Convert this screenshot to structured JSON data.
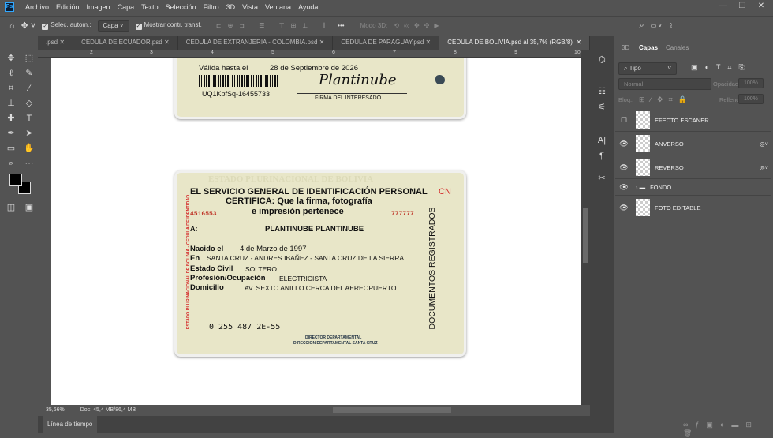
{
  "app": {
    "logo": "Ps"
  },
  "menu": [
    "Archivo",
    "Edición",
    "Imagen",
    "Capa",
    "Texto",
    "Selección",
    "Filtro",
    "3D",
    "Vista",
    "Ventana",
    "Ayuda"
  ],
  "window_controls": {
    "minimize": "—",
    "restore": "❐",
    "close": "✕"
  },
  "options": {
    "auto_select_label": "Selec. autom.:",
    "auto_select_checked": true,
    "auto_select_value": "Capa",
    "show_transform_label": "Mostrar contr. transf.",
    "show_transform_checked": true,
    "mode3d_label": "Modo 3D:",
    "more": "•••"
  },
  "tabs": [
    {
      "label": ".psd",
      "active": false
    },
    {
      "label": "CEDULA DE ECUADOR.psd",
      "active": false
    },
    {
      "label": "CEDULA DE EXTRANJERIA - COLOMBIA.psd",
      "active": false
    },
    {
      "label": "CEDULA DE PARAGUAY.psd",
      "active": false
    },
    {
      "label": "CEDULA DE BOLIVIA.psd al 35,7% (RGB/8)",
      "active": true
    }
  ],
  "tabs_overflow": ">>",
  "ruler": [
    "2",
    "3",
    "4",
    "5",
    "6",
    "7",
    "8",
    "9",
    "10"
  ],
  "card_front_top": {
    "valid_label": "Válida hasta el",
    "valid_date": "28 de Septiembre de 2026",
    "code": "UQ1KpfSq-16455733",
    "signature": "Plantinube",
    "signature_label": "FIRMA DEL INTERESADO"
  },
  "card_back": {
    "watermark": "ESTADO PLURINACIONAL DE BOLIVIA",
    "side_text": "ESTADO PLURINACIONAL DE BOLIVIA - CEDULA DE IDENTIDAD",
    "line1": "EL SERVICIO GENERAL DE IDENTIFICACIÓN PERSONAL",
    "line2": "CERTIFICA: Que la firma, fotografía",
    "line3": "e impresión pertenece",
    "number_left": "4516553",
    "number_right": "777777",
    "cn": "CN",
    "to_label": "A:",
    "name": "PLANTINUBE PLANTINUBE",
    "born_label": "Nacido el",
    "born": "4 de Marzo de 1997",
    "in_label": "En",
    "place": "SANTA CRUZ - ANDRES IBAÑEZ - SANTA CRUZ DE LA SIERRA",
    "civil_label": "Estado Civil",
    "civil": "SOLTERO",
    "job_label": "Profesión/Ocupación",
    "job": "ELECTRICISTA",
    "address_label": "Domicilio",
    "address": "AV. SEXTO ANILLO CERCA DEL AEREOPUERTO",
    "serial": "0 255 487 2E-55",
    "director1": "DIRECTOR DEPARTAMENTAL",
    "director2": "DIRECCION DEPARTAMENTAL SANTA CRUZ",
    "vertical": "DOCUMENTOS REGISTRADOS"
  },
  "status": {
    "zoom": "35,66%",
    "doc": "Doc: 45,4 MB/86,4 MB"
  },
  "timeline": {
    "label": "Línea de tiempo"
  },
  "panel": {
    "tabs": [
      "3D",
      "Capas",
      "Canales"
    ],
    "active_tab": "Capas",
    "filter": "Tipo",
    "blend": "Normal",
    "opacity_label": "Opacidad:",
    "opacity": "100%",
    "lock_label": "Bloq.:",
    "fill_label": "Relleno:",
    "fill": "100%",
    "layers": [
      {
        "name": "EFECTO ESCANER",
        "visible": false
      },
      {
        "name": "ANVERSO",
        "visible": true
      },
      {
        "name": "REVERSO",
        "visible": true
      },
      {
        "name": "FONDO",
        "visible": true,
        "group": true
      },
      {
        "name": "FOTO EDITABLE",
        "visible": true
      }
    ]
  },
  "colors": {
    "accent": "#31a8ff",
    "card": "#e8e6c8",
    "red": "#d42a2a"
  }
}
